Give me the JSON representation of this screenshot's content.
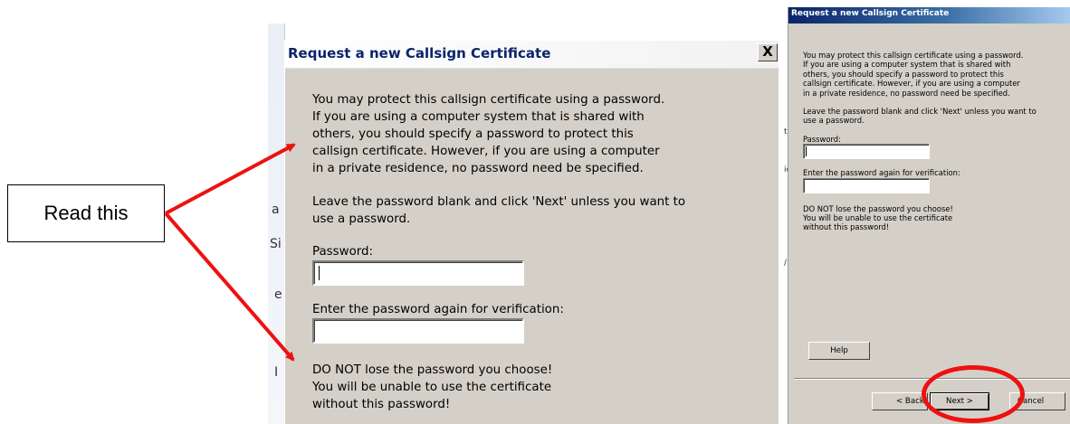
{
  "callout": {
    "text": "Read this"
  },
  "zoomed_dialog": {
    "title": "Request a new Callsign Certificate",
    "close_symbol": "X",
    "behind_fragments": [
      "Si",
      "a",
      "e",
      "I"
    ],
    "intro_lines": [
      "You may protect this callsign certificate using a password.",
      "If you are using a computer system that is shared with",
      "others, you should specify a password to protect this",
      "callsign certificate. However, if you are using a computer",
      "in a private residence, no password need be specified."
    ],
    "blank_lines": [
      "Leave the password blank and click 'Next' unless you want to",
      "use a password."
    ],
    "password_label": "Password:",
    "password_value": "",
    "verify_label": "Enter the password again for verification:",
    "verify_value": "",
    "warning_lines": [
      "DO NOT lose the password you choose!",
      "You will be unable to use the certificate",
      "without this password!"
    ]
  },
  "small_dialog": {
    "title": "Request a new Callsign Certificate",
    "behind_fragments": [
      "ic",
      "t",
      "/"
    ],
    "intro_lines": [
      "You may protect this callsign certificate using a password.",
      "If you are using a computer system that is shared with",
      "others, you should specify a password to protect this",
      "callsign certificate. However, if you are using a computer",
      "in a private residence, no password need be specified."
    ],
    "blank_lines": [
      "Leave the password blank and click 'Next' unless you want to",
      "use a password."
    ],
    "password_label": "Password:",
    "verify_label": "Enter the password again for verification:",
    "warning_lines": [
      "DO NOT lose the password you choose!",
      "You will be unable to use the certificate",
      "without this password!"
    ],
    "help_label": "Help",
    "back_label": "< Back",
    "next_label": "Next >",
    "cancel_label": "Cancel"
  },
  "colors": {
    "arrow": "#ee1111",
    "dialog_face": "#d4d0c8",
    "title_text_zoomed": "#0a246a",
    "titlebar_active": "#0a246a"
  }
}
